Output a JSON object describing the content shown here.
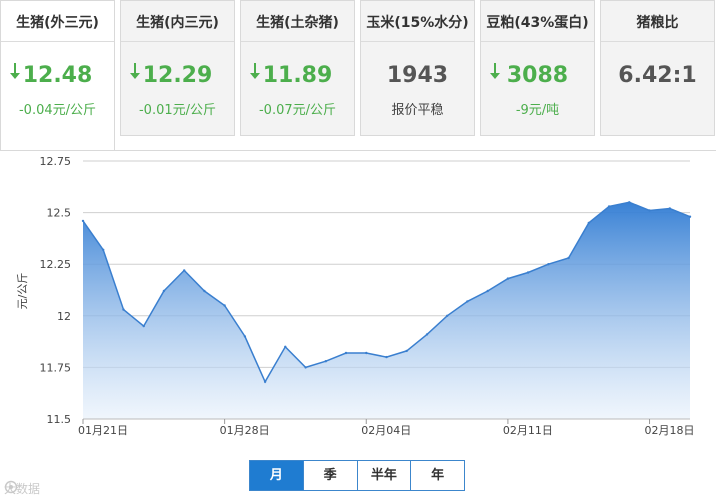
{
  "cards": [
    {
      "title": "生猪(外三元)",
      "value": "12.48",
      "direction": "down",
      "change": "-0.04元/公斤"
    },
    {
      "title": "生猪(内三元)",
      "value": "12.29",
      "direction": "down",
      "change": "-0.01元/公斤"
    },
    {
      "title": "生猪(土杂猪)",
      "value": "11.89",
      "direction": "down",
      "change": "-0.07元/公斤"
    },
    {
      "title": "玉米(15%水分)",
      "value": "1943",
      "direction": "none",
      "change": "报价平稳"
    },
    {
      "title": "豆粕(43%蛋白)",
      "value": "3088",
      "direction": "down",
      "change": "-9元/吨"
    },
    {
      "title": "猪粮比",
      "value": "6.42:1",
      "direction": "none",
      "change": ""
    }
  ],
  "colors": {
    "down": "#4cae4c",
    "accent": "#1f7cd1",
    "line": "#3a7fcf"
  },
  "chart_data": {
    "type": "area",
    "title": "",
    "xlabel": "",
    "ylabel": "元/公斤",
    "ylim": [
      11.5,
      12.75
    ],
    "yticks": [
      "11.5",
      "11.75",
      "12",
      "12.25",
      "12.5",
      "12.75"
    ],
    "xticks": [
      {
        "label": "01月21日",
        "index": 0
      },
      {
        "label": "01月28日",
        "index": 7
      },
      {
        "label": "02月04日",
        "index": 14
      },
      {
        "label": "02月11日",
        "index": 21
      },
      {
        "label": "02月18日",
        "index": 28
      }
    ],
    "grid": true,
    "series": [
      {
        "values": [
          12.46,
          12.32,
          12.03,
          11.95,
          12.12,
          12.22,
          12.12,
          12.05,
          11.9,
          11.68,
          11.85,
          11.75,
          11.78,
          11.82,
          11.82,
          11.8,
          11.83,
          11.91,
          12.0,
          12.07,
          12.12,
          12.18,
          12.21,
          12.25,
          12.28,
          12.45,
          12.53,
          12.55,
          12.51,
          12.52,
          12.48
        ]
      }
    ]
  },
  "range_tabs": [
    "月",
    "季",
    "半年",
    "年"
  ],
  "active_tab": 0,
  "watermark": "大数据"
}
